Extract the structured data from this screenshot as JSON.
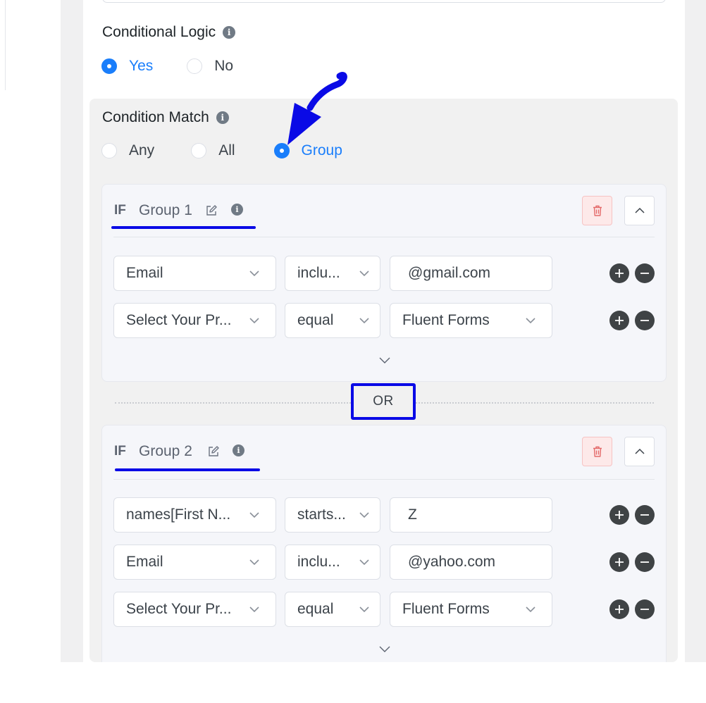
{
  "conditional_logic": {
    "label": "Conditional Logic",
    "info_icon": "info-icon",
    "options": [
      {
        "label": "Yes",
        "checked": true
      },
      {
        "label": "No",
        "checked": false
      }
    ]
  },
  "condition_match": {
    "label": "Condition Match",
    "info_icon": "info-icon",
    "options": [
      {
        "label": "Any",
        "checked": false
      },
      {
        "label": "All",
        "checked": false
      },
      {
        "label": "Group",
        "checked": true
      }
    ]
  },
  "groups": [
    {
      "if_label": "IF",
      "name": "Group 1",
      "rows": [
        {
          "field": "Email",
          "operator": "inclu...",
          "value": "@gmail.com",
          "value_type": "input"
        },
        {
          "field": "Select Your Pr...",
          "operator": "equal",
          "value": "Fluent Forms",
          "value_type": "select"
        }
      ]
    },
    {
      "if_label": "IF",
      "name": "Group 2",
      "rows": [
        {
          "field": "names[First N...",
          "operator": "starts...",
          "value": "Z",
          "value_type": "input"
        },
        {
          "field": "Email",
          "operator": "inclu...",
          "value": "@yahoo.com",
          "value_type": "input"
        },
        {
          "field": "Select Your Pr...",
          "operator": "equal",
          "value": "Fluent Forms",
          "value_type": "select"
        }
      ]
    }
  ],
  "or_separator": "OR",
  "colors": {
    "accent_blue": "#1a7efb",
    "annotation_blue": "#0a0ae6",
    "delete_red": "#e46a6a"
  },
  "icons": [
    "info-icon",
    "edit-icon",
    "trash-icon",
    "chevron-up-icon",
    "chevron-down-icon",
    "plus-circle-icon",
    "minus-circle-icon",
    "annotation-arrow"
  ]
}
